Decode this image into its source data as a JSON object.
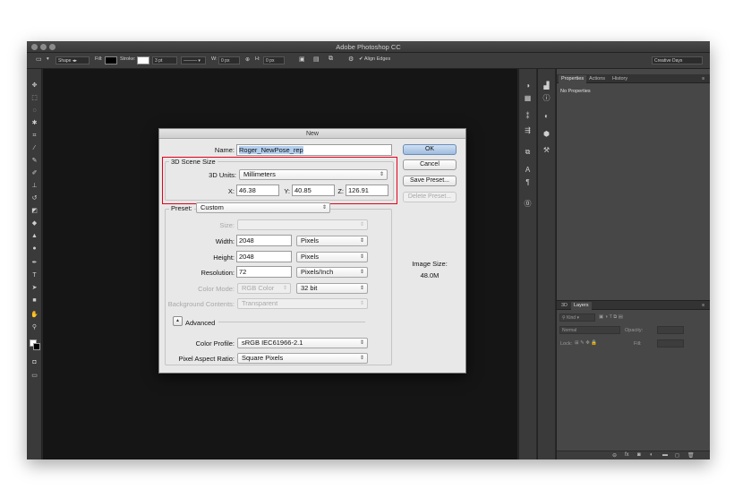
{
  "window": {
    "title": "Adobe Photoshop CC"
  },
  "options_bar": {
    "mode": "Shape",
    "fill_label": "Fill:",
    "stroke_label": "Stroke:",
    "stroke_width": "3 pt",
    "w_label": "W:",
    "w_value": "0 px",
    "h_label": "H:",
    "h_value": "0 px",
    "align_edges": "Align Edges",
    "workspace": "Creative Days"
  },
  "right_panel": {
    "tabs": [
      "Properties",
      "Actions",
      "History"
    ],
    "no_properties": "No Properties",
    "layers_tabs": [
      "3D",
      "Layers"
    ],
    "kind_label": "Kind",
    "blend_mode": "Normal",
    "opacity_label": "Opacity:",
    "lock_label": "Lock:",
    "fill_label": "Fill:"
  },
  "dialog": {
    "title": "New",
    "name_label": "Name:",
    "name_value": "Roger_NewPose_rep",
    "scene_group": "3D Scene Size",
    "units_label": "3D Units:",
    "units_value": "Millimeters",
    "x_label": "X:",
    "x_value": "46.38",
    "y_label": "Y:",
    "y_value": "40.85",
    "z_label": "Z:",
    "z_value": "126.91",
    "preset_label": "Preset:",
    "preset_value": "Custom",
    "size_label": "Size:",
    "width_label": "Width:",
    "width_value": "2048",
    "width_unit": "Pixels",
    "height_label": "Height:",
    "height_value": "2048",
    "height_unit": "Pixels",
    "resolution_label": "Resolution:",
    "resolution_value": "72",
    "resolution_unit": "Pixels/Inch",
    "color_mode_label": "Color Mode:",
    "color_mode_value": "RGB Color",
    "bit_depth": "32 bit",
    "background_label": "Background Contents:",
    "background_value": "Transparent",
    "advanced_label": "Advanced",
    "color_profile_label": "Color Profile:",
    "color_profile_value": "sRGB IEC61966-2.1",
    "pixel_aspect_label": "Pixel Aspect Ratio:",
    "pixel_aspect_value": "Square Pixels",
    "buttons": {
      "ok": "OK",
      "cancel": "Cancel",
      "save_preset": "Save Preset...",
      "delete_preset": "Delete Preset..."
    },
    "image_size_label": "Image Size:",
    "image_size_value": "48.0M"
  },
  "colors": {
    "highlight": "#e3001b",
    "ok_button": "#9fbcdf"
  }
}
